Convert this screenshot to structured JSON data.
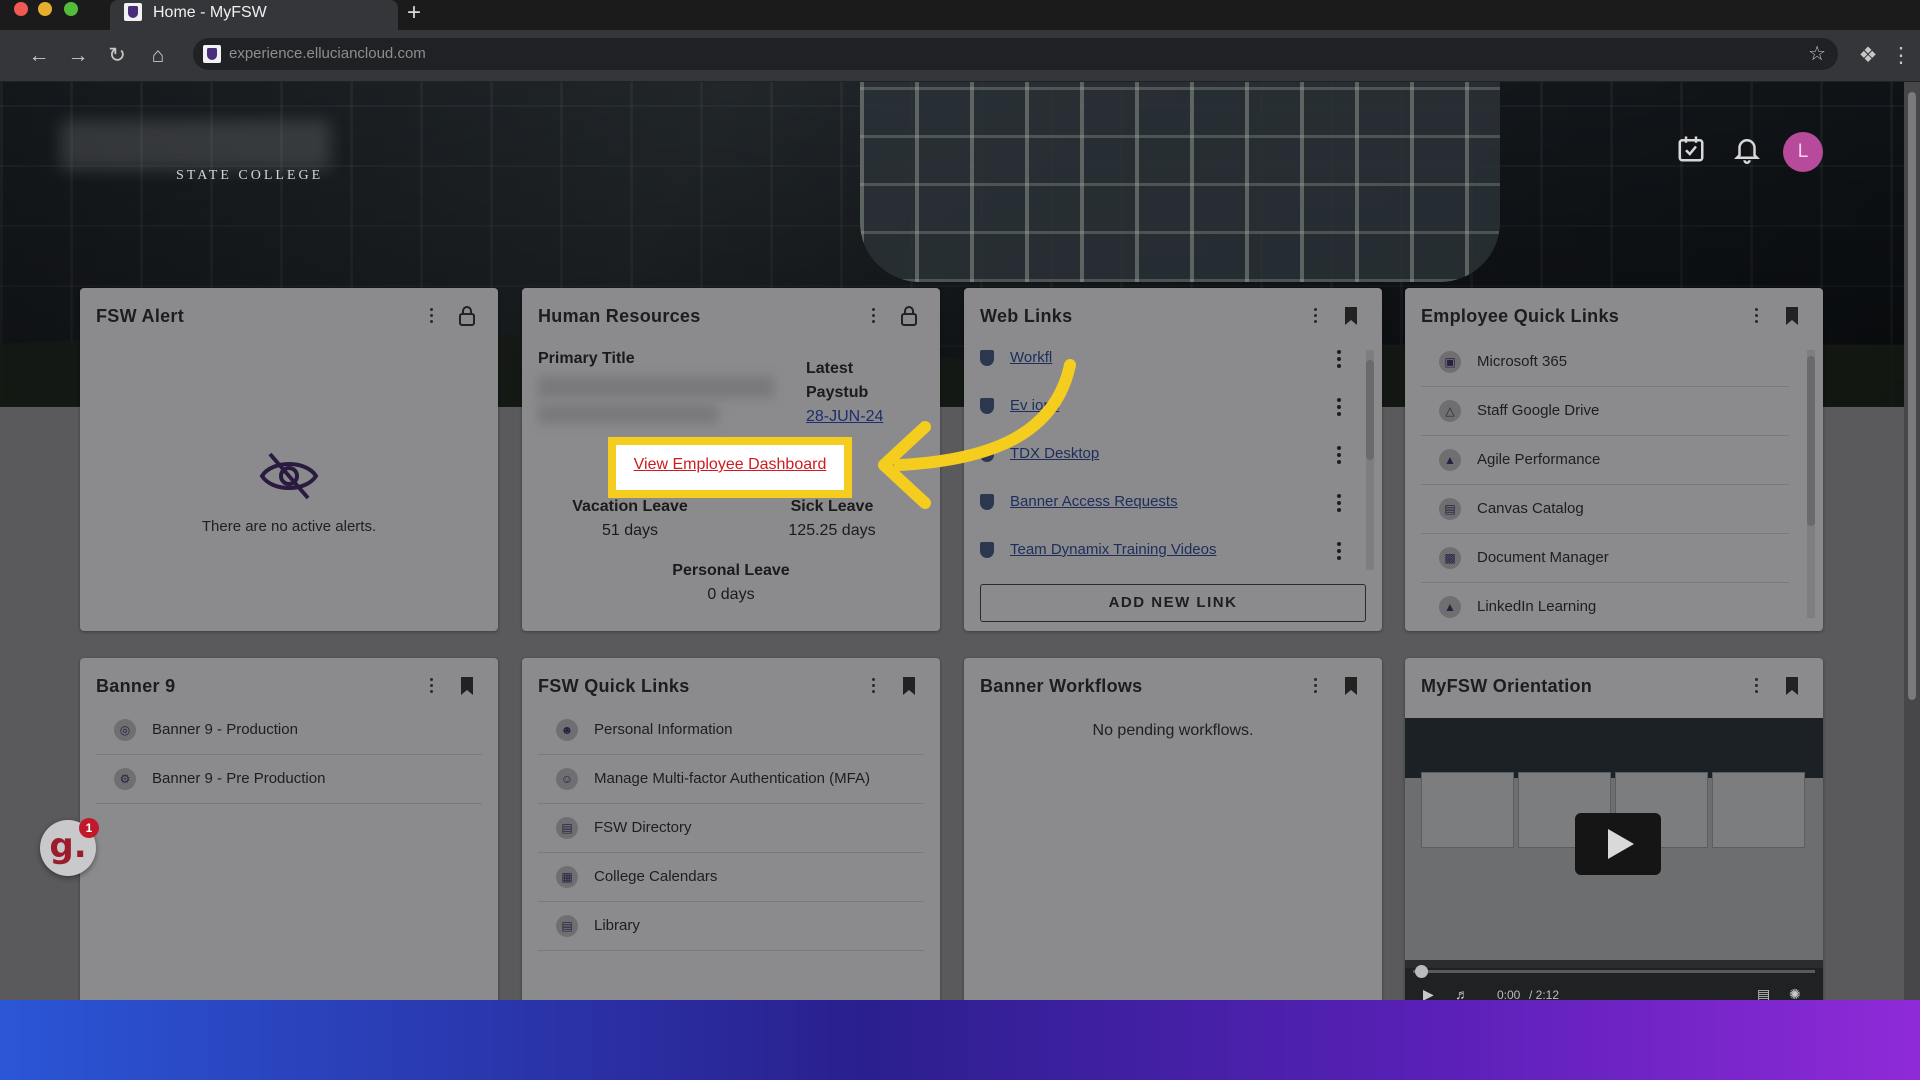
{
  "browser": {
    "tab_title": "Home - MyFSW",
    "url": "experience.elluciancloud.com"
  },
  "header": {
    "logo_subtitle": "STATE COLLEGE",
    "avatar_initial": "L",
    "accent_color": "#b84a9c"
  },
  "cards": {
    "fsw_alert": {
      "title": "FSW Alert",
      "empty_text": "There are no active alerts."
    },
    "human_resources": {
      "title": "Human Resources",
      "primary_title_label": "Primary Title",
      "latest_paystub_label_1": "Latest",
      "latest_paystub_label_2": "Paystub",
      "paystub_date": "28-JUN-24",
      "dashboard_link": "View Employee Dashboard",
      "vacation_label": "Vacation Leave",
      "vacation_value": "51 days",
      "sick_label": "Sick Leave",
      "sick_value": "125.25 days",
      "personal_label": "Personal Leave",
      "personal_value": "0 days"
    },
    "web_links": {
      "title": "Web Links",
      "items": [
        {
          "label": "Workfl"
        },
        {
          "label": "Ev  ions"
        },
        {
          "label": "TDX Desktop"
        },
        {
          "label": "Banner Access Requests"
        },
        {
          "label": "Team Dynamix Training Videos"
        }
      ],
      "add_button": "ADD NEW LINK"
    },
    "employee_quick_links": {
      "title": "Employee Quick Links",
      "items": [
        {
          "label": "Microsoft 365"
        },
        {
          "label": "Staff Google Drive"
        },
        {
          "label": "Agile Performance"
        },
        {
          "label": "Canvas Catalog"
        },
        {
          "label": "Document Manager"
        },
        {
          "label": "LinkedIn Learning"
        }
      ]
    },
    "banner9": {
      "title": "Banner 9",
      "items": [
        {
          "label": "Banner 9 - Production"
        },
        {
          "label": "Banner 9 - Pre Production"
        }
      ]
    },
    "fsw_quick_links": {
      "title": "FSW Quick Links",
      "items": [
        {
          "label": "Personal Information"
        },
        {
          "label": "Manage Multi-factor Authentication (MFA)"
        },
        {
          "label": "FSW Directory"
        },
        {
          "label": "College Calendars"
        },
        {
          "label": "Library"
        }
      ]
    },
    "banner_workflows": {
      "title": "Banner Workflows",
      "empty_text": "No pending workflows."
    },
    "orientation": {
      "title": "MyFSW Orientation",
      "video_time": "0:00",
      "video_duration": "/ 2:12"
    }
  },
  "widget": {
    "letter": "g.",
    "badge_count": "1"
  },
  "colors": {
    "highlight": "#f4cd1f",
    "link_red": "#d01a21",
    "arrow": "#f4cd1f"
  }
}
